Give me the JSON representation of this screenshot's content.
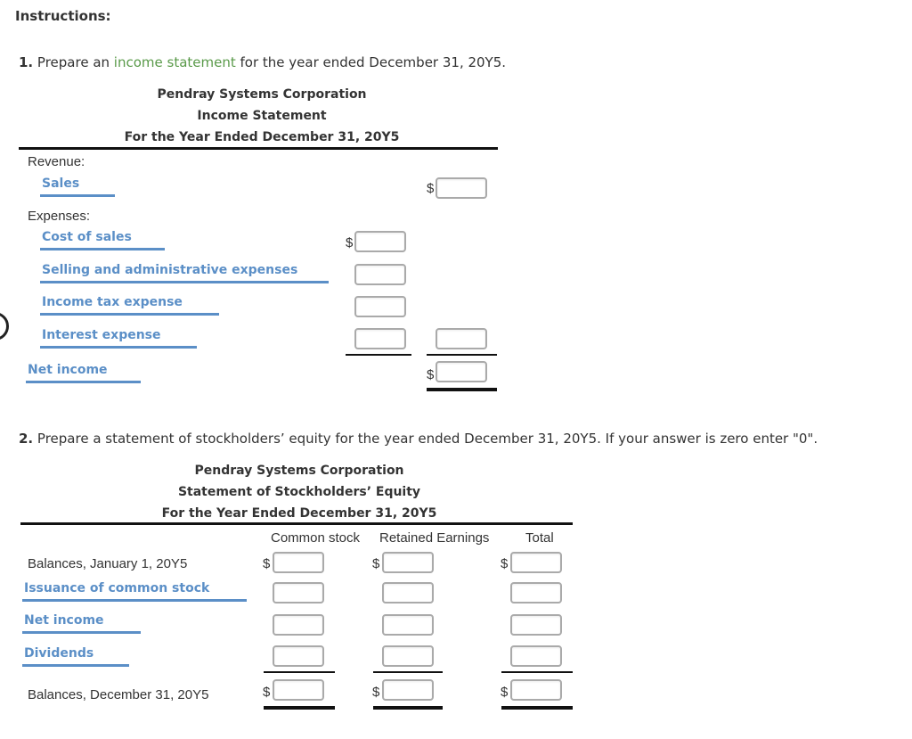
{
  "instructions_title": "Instructions:",
  "q1": {
    "number": "1.",
    "text_before": "Prepare an",
    "link": "income statement",
    "text_after": "for the year ended December 31, 20Y5.",
    "header": {
      "company": "Pendray Systems Corporation",
      "statement": "Income Statement",
      "period": "For the Year Ended December 31, 20Y5"
    },
    "revenue_label": "Revenue:",
    "sales_label": "Sales",
    "expenses_label": "Expenses:",
    "expenses": [
      "Cost of sales",
      "Selling and administrative expenses",
      "Income tax expense",
      "Interest expense"
    ],
    "net_income_label": "Net income",
    "currency_symbol": "$",
    "inputs": {
      "sales": "",
      "cost_of_sales": "",
      "selling_admin": "",
      "income_tax": "",
      "interest": "",
      "total_expenses": "",
      "net_income": ""
    }
  },
  "q2": {
    "number": "2.",
    "text": "Prepare a statement of stockholders’ equity for the year ended December 31, 20Y5. If your answer is zero enter \"0\".",
    "header": {
      "company": "Pendray Systems Corporation",
      "statement": "Statement of Stockholders’ Equity",
      "period": "For the Year Ended December 31, 20Y5"
    },
    "columns": [
      "Common stock",
      "Retained Earnings",
      "Total"
    ],
    "rows": [
      {
        "label": "Balances, January 1, 20Y5",
        "style": "plain",
        "dollar": true
      },
      {
        "label": "Issuance of common stock",
        "style": "blue",
        "dollar": false
      },
      {
        "label": "Net income",
        "style": "blue",
        "dollar": false
      },
      {
        "label": "Dividends",
        "style": "blue",
        "dollar": false
      },
      {
        "label": "Balances, December 31, 20Y5",
        "style": "plain",
        "dollar": true
      }
    ],
    "currency_symbol": "$"
  }
}
